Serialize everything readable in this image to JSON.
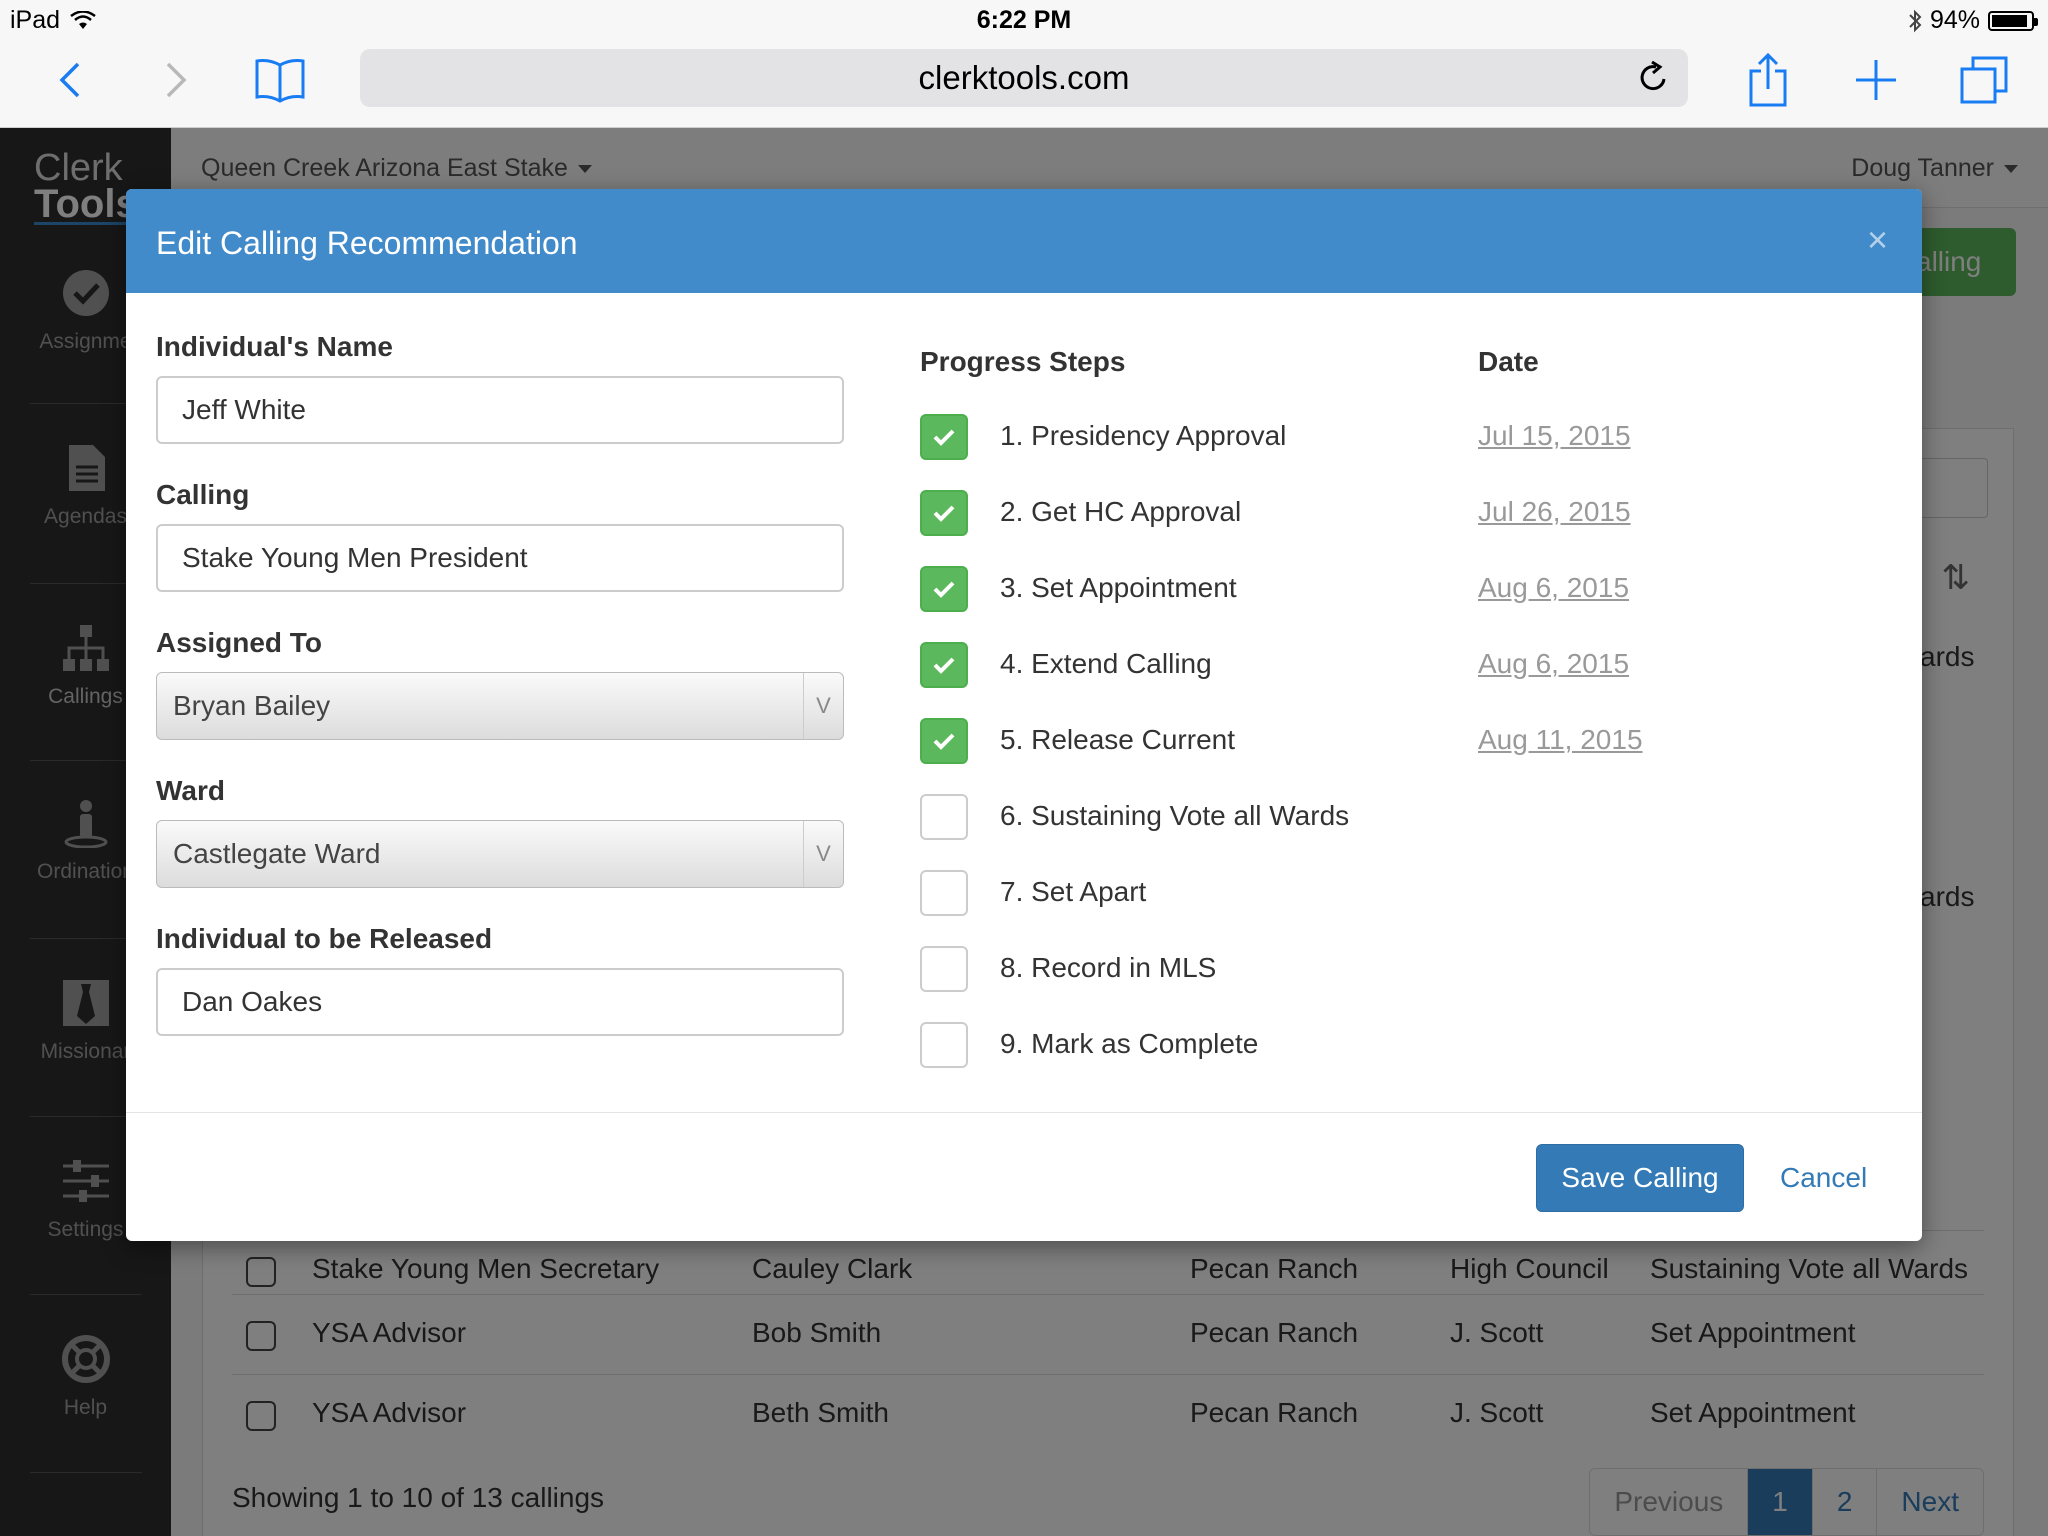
{
  "status_bar": {
    "device": "iPad",
    "time": "6:22 PM",
    "battery": "94%",
    "battery_level": 0.94
  },
  "browser": {
    "url": "clerktools.com"
  },
  "app": {
    "logo_line1": "Clerk",
    "logo_line2": "Tools",
    "stake": "Queen Creek Arizona East Stake",
    "user": "Doug Tanner",
    "new_calling_button": "alling",
    "sidebar": [
      {
        "label": "Assignme",
        "icon": "checkmark-circle-icon"
      },
      {
        "label": "Agendas",
        "icon": "document-icon"
      },
      {
        "label": "Callings",
        "icon": "org-chart-icon"
      },
      {
        "label": "Ordination",
        "icon": "person-icon"
      },
      {
        "label": "Missionar",
        "icon": "tie-icon"
      },
      {
        "label": "Settings",
        "icon": "sliders-icon"
      },
      {
        "label": "Help",
        "icon": "lifebuoy-icon"
      }
    ],
    "ghost_text": [
      "ards",
      "ards"
    ],
    "rows": [
      {
        "calling": "Stake Young Men Secretary",
        "name": "Cauley Clark",
        "ward": "Pecan Ranch",
        "assigned": "High Council",
        "status": "Sustaining Vote all Wards"
      },
      {
        "calling": "YSA Advisor",
        "name": "Bob Smith",
        "ward": "Pecan Ranch",
        "assigned": "J. Scott",
        "status": "Set Appointment"
      },
      {
        "calling": "YSA Advisor",
        "name": "Beth Smith",
        "ward": "Pecan Ranch",
        "assigned": "J. Scott",
        "status": "Set Appointment"
      }
    ],
    "showing": "Showing 1 to 10 of 13 callings",
    "pager": {
      "previous": "Previous",
      "page1": "1",
      "page2": "2",
      "next": "Next"
    }
  },
  "modal": {
    "title": "Edit Calling Recommendation",
    "close": "×",
    "fields": {
      "name_label": "Individual's Name",
      "name_value": "Jeff White",
      "calling_label": "Calling",
      "calling_value": "Stake Young Men President",
      "assigned_label": "Assigned To",
      "assigned_value": "Bryan Bailey",
      "ward_label": "Ward",
      "ward_value": "Castlegate Ward",
      "released_label": "Individual to be Released",
      "released_value": "Dan Oakes"
    },
    "progress_header": "Progress Steps",
    "date_header": "Date",
    "steps": [
      {
        "label": "1. Presidency Approval",
        "checked": true,
        "date": "Jul 15, 2015"
      },
      {
        "label": "2. Get HC Approval",
        "checked": true,
        "date": "Jul 26, 2015"
      },
      {
        "label": "3. Set Appointment",
        "checked": true,
        "date": "Aug 6, 2015"
      },
      {
        "label": "4. Extend Calling",
        "checked": true,
        "date": "Aug 6, 2015"
      },
      {
        "label": "5. Release Current",
        "checked": true,
        "date": "Aug 11, 2015"
      },
      {
        "label": "6. Sustaining Vote all Wards",
        "checked": false,
        "date": ""
      },
      {
        "label": "7. Set Apart",
        "checked": false,
        "date": ""
      },
      {
        "label": "8. Record in MLS",
        "checked": false,
        "date": ""
      },
      {
        "label": "9. Mark as Complete",
        "checked": false,
        "date": ""
      }
    ],
    "save_button": "Save Calling",
    "cancel_button": "Cancel"
  },
  "colors": {
    "modal_header": "#428bca",
    "check_green": "#5cb85c",
    "primary": "#337ab7",
    "ios_blue": "#1a7cf3"
  }
}
